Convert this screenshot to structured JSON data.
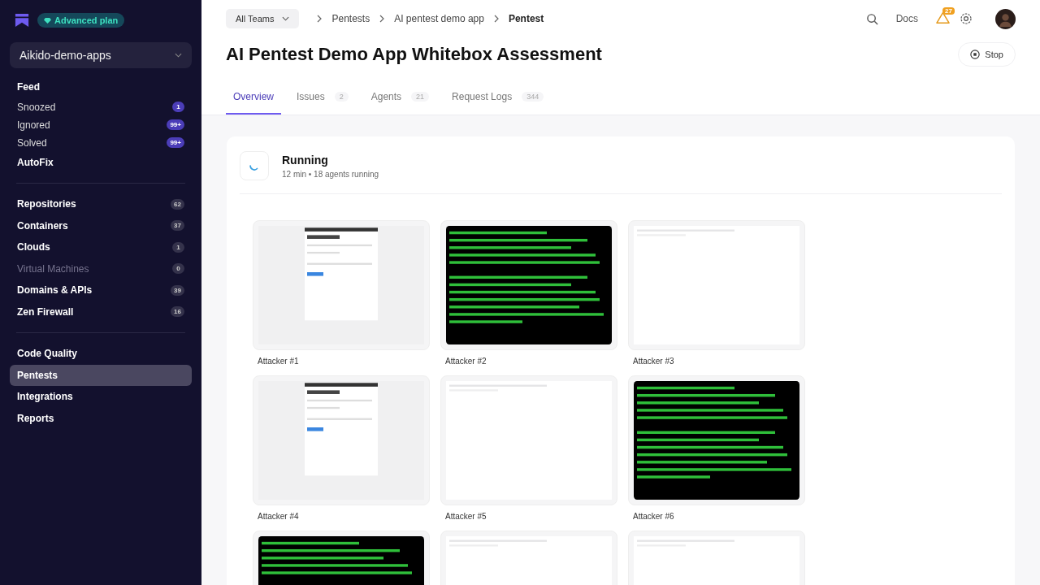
{
  "sidebar": {
    "plan": "Advanced plan",
    "workspace": "Aikido-demo-apps",
    "groups": [
      {
        "items": [
          {
            "label": "Feed",
            "kind": "heading",
            "selected": false,
            "disabled": false
          },
          {
            "label": "Snoozed",
            "kind": "sub",
            "count": "1",
            "selected": false,
            "disabled": false
          },
          {
            "label": "Ignored",
            "kind": "sub",
            "count": "99+",
            "selected": false,
            "disabled": false
          },
          {
            "label": "Solved",
            "kind": "sub",
            "count": "99+",
            "selected": false,
            "disabled": false
          },
          {
            "label": "AutoFix",
            "kind": "heading",
            "selected": false,
            "disabled": false
          }
        ]
      },
      {
        "items": [
          {
            "label": "Repositories",
            "kind": "heading",
            "count": "62",
            "selected": false,
            "disabled": false
          },
          {
            "label": "Containers",
            "kind": "heading",
            "count": "37",
            "selected": false,
            "disabled": false
          },
          {
            "label": "Clouds",
            "kind": "heading",
            "count": "1",
            "selected": false,
            "disabled": false
          },
          {
            "label": "Virtual Machines",
            "kind": "heading",
            "count": "0",
            "selected": false,
            "disabled": true
          },
          {
            "label": "Domains & APIs",
            "kind": "heading",
            "count": "39",
            "selected": false,
            "disabled": false
          },
          {
            "label": "Zen Firewall",
            "kind": "heading",
            "count": "16",
            "selected": false,
            "disabled": false
          }
        ]
      },
      {
        "items": [
          {
            "label": "Code Quality",
            "kind": "heading",
            "selected": false,
            "disabled": false
          },
          {
            "label": "Pentests",
            "kind": "heading",
            "selected": true,
            "disabled": false
          },
          {
            "label": "Integrations",
            "kind": "heading",
            "selected": false,
            "disabled": false
          },
          {
            "label": "Reports",
            "kind": "heading",
            "selected": false,
            "disabled": false
          }
        ]
      }
    ]
  },
  "topbar": {
    "team": "All Teams",
    "breadcrumbs": [
      "Pentests",
      "AI pentest demo app",
      "Pentest"
    ],
    "docs": "Docs",
    "alerts": "27"
  },
  "title": "AI Pentest Demo App Whitebox Assessment",
  "stop": "Stop",
  "tabs": [
    {
      "label": "Overview",
      "selected": true
    },
    {
      "label": "Issues",
      "count": "2",
      "selected": false
    },
    {
      "label": "Agents",
      "count": "21",
      "selected": false
    },
    {
      "label": "Request Logs",
      "count": "344",
      "selected": false
    }
  ],
  "status": {
    "title": "Running",
    "subtitle": "12 min • 18 agents running"
  },
  "attackers": [
    {
      "label": "Attacker #1",
      "kind": "web"
    },
    {
      "label": "Attacker #2",
      "kind": "terminal"
    },
    {
      "label": "Attacker #3",
      "kind": "blank"
    },
    {
      "label": "Attacker #4",
      "kind": "web"
    },
    {
      "label": "Attacker #5",
      "kind": "blank"
    },
    {
      "label": "Attacker #6",
      "kind": "terminal"
    },
    {
      "kind": "terminal"
    },
    {
      "kind": "blank"
    },
    {
      "kind": "blank"
    }
  ]
}
